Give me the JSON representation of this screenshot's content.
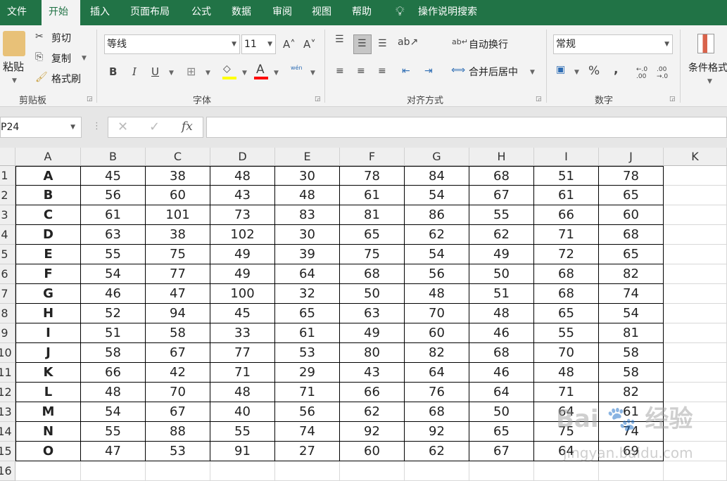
{
  "tabs": [
    "文件",
    "开始",
    "插入",
    "页面布局",
    "公式",
    "数据",
    "审阅",
    "视图",
    "帮助"
  ],
  "active_tab": "开始",
  "tell_me": "操作说明搜索",
  "clipboard": {
    "paste": "粘贴",
    "cut": "剪切",
    "copy": "复制",
    "format_painter": "格式刷",
    "label": "剪贴板"
  },
  "font": {
    "name": "等线",
    "size": "11",
    "label": "字体",
    "bold": "B",
    "italic": "I",
    "underline": "U",
    "phonetic": "wén"
  },
  "alignment": {
    "wrap": "自动换行",
    "merge": "合并后居中",
    "label": "对齐方式"
  },
  "number": {
    "format": "常规",
    "percent": "%",
    "comma": ",",
    "label": "数字"
  },
  "styles": {
    "conditional": "条件格式"
  },
  "name_box": "P24",
  "formula": "",
  "accent": "#217346",
  "columns": [
    "A",
    "B",
    "C",
    "D",
    "E",
    "F",
    "G",
    "H",
    "I",
    "J",
    "K"
  ],
  "rows": [
    [
      "A",
      "45",
      "38",
      "48",
      "30",
      "78",
      "84",
      "68",
      "51",
      "78"
    ],
    [
      "B",
      "56",
      "60",
      "43",
      "48",
      "61",
      "54",
      "67",
      "61",
      "65"
    ],
    [
      "C",
      "61",
      "101",
      "73",
      "83",
      "81",
      "86",
      "55",
      "66",
      "60"
    ],
    [
      "D",
      "63",
      "38",
      "102",
      "30",
      "65",
      "62",
      "62",
      "71",
      "68"
    ],
    [
      "E",
      "55",
      "75",
      "49",
      "39",
      "75",
      "54",
      "49",
      "72",
      "65"
    ],
    [
      "F",
      "54",
      "77",
      "49",
      "64",
      "68",
      "56",
      "50",
      "68",
      "82"
    ],
    [
      "G",
      "46",
      "47",
      "100",
      "32",
      "50",
      "48",
      "51",
      "68",
      "74"
    ],
    [
      "H",
      "52",
      "94",
      "45",
      "65",
      "63",
      "70",
      "48",
      "65",
      "54"
    ],
    [
      "I",
      "51",
      "58",
      "33",
      "61",
      "49",
      "60",
      "46",
      "55",
      "81"
    ],
    [
      "J",
      "58",
      "67",
      "77",
      "53",
      "80",
      "82",
      "68",
      "70",
      "58"
    ],
    [
      "K",
      "66",
      "42",
      "71",
      "29",
      "43",
      "64",
      "46",
      "48",
      "58"
    ],
    [
      "L",
      "48",
      "70",
      "48",
      "71",
      "66",
      "76",
      "64",
      "71",
      "82"
    ],
    [
      "M",
      "54",
      "67",
      "40",
      "56",
      "62",
      "68",
      "50",
      "64",
      "61"
    ],
    [
      "N",
      "55",
      "88",
      "55",
      "74",
      "92",
      "92",
      "65",
      "75",
      "74"
    ],
    [
      "O",
      "47",
      "53",
      "91",
      "27",
      "60",
      "62",
      "67",
      "64",
      "69"
    ]
  ],
  "row_numbers": [
    "1",
    "2",
    "3",
    "4",
    "5",
    "6",
    "7",
    "8",
    "9",
    "10",
    "11",
    "12",
    "13",
    "14",
    "15",
    "16"
  ],
  "watermark": "Baidu经验 jingyan.baidu.com"
}
